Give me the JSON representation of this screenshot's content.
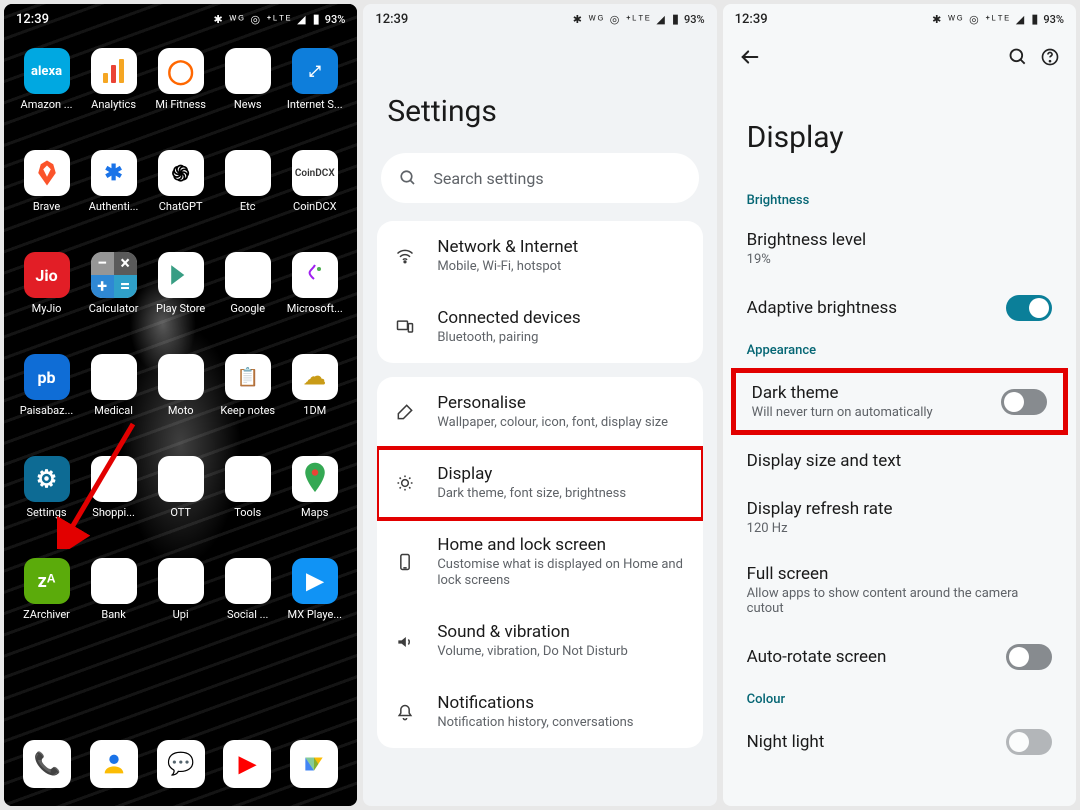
{
  "status": {
    "time": "12:39",
    "icons": "✱ ᵂᴳ ◎ ⁺ᴸᵀᴱ ◢",
    "battery": "93%"
  },
  "home": {
    "apps": [
      {
        "label": "Amazon ...",
        "name": "amazon-alexa-icon",
        "cls": "ic-alexa",
        "glyph": "alexa"
      },
      {
        "label": "Analytics",
        "name": "analytics-icon",
        "cls": "ic-analytics",
        "glyph": ""
      },
      {
        "label": "Mi Fitness",
        "name": "mi-fitness-icon",
        "cls": "ic-mifitness",
        "glyph": "◯"
      },
      {
        "label": "News",
        "name": "news-icon",
        "cls": "ic-news",
        "glyph": ""
      },
      {
        "label": "Internet S...",
        "name": "internet-speed-icon",
        "cls": "ic-inet",
        "glyph": "⤢"
      },
      {
        "label": "Brave",
        "name": "brave-icon",
        "cls": "ic-brave",
        "glyph": ""
      },
      {
        "label": "Authenti...",
        "name": "authenticator-icon",
        "cls": "ic-authentic",
        "glyph": "✱"
      },
      {
        "label": "ChatGPT",
        "name": "chatgpt-icon",
        "cls": "ic-chatgpt",
        "glyph": "֍"
      },
      {
        "label": "Etc",
        "name": "etc-folder-icon",
        "cls": "ic-etc",
        "glyph": ""
      },
      {
        "label": "CoinDCX",
        "name": "coindcx-icon",
        "cls": "ic-coindcx",
        "glyph": "CoinDCX"
      },
      {
        "label": "MyJio",
        "name": "myjio-icon",
        "cls": "ic-jio",
        "glyph": "Jio"
      },
      {
        "label": "Calculator",
        "name": "calculator-icon",
        "cls": "ic-calc",
        "glyph": ""
      },
      {
        "label": "Play Store",
        "name": "play-store-icon",
        "cls": "ic-play",
        "glyph": ""
      },
      {
        "label": "Google",
        "name": "google-folder-icon",
        "cls": "ic-google",
        "glyph": ""
      },
      {
        "label": "Microsoft...",
        "name": "microsoft-icon",
        "cls": "ic-ms",
        "glyph": ""
      },
      {
        "label": "Paisabaz...",
        "name": "paisabazaar-icon",
        "cls": "ic-pb",
        "glyph": "pb"
      },
      {
        "label": "Medical",
        "name": "medical-folder-icon",
        "cls": "ic-medical",
        "glyph": ""
      },
      {
        "label": "Moto",
        "name": "moto-folder-icon",
        "cls": "ic-moto",
        "glyph": ""
      },
      {
        "label": "Keep notes",
        "name": "keep-notes-icon",
        "cls": "ic-keep",
        "glyph": "📋"
      },
      {
        "label": "1DM",
        "name": "1dm-icon",
        "cls": "ic-1dm",
        "glyph": "☁"
      },
      {
        "label": "Settings",
        "name": "settings-icon",
        "cls": "ic-settings",
        "glyph": "⚙"
      },
      {
        "label": "Shoppi...",
        "name": "shopping-folder-icon",
        "cls": "ic-shoppi",
        "glyph": ""
      },
      {
        "label": "OTT",
        "name": "ott-folder-icon",
        "cls": "ic-ott",
        "glyph": ""
      },
      {
        "label": "Tools",
        "name": "tools-folder-icon",
        "cls": "ic-tools",
        "glyph": ""
      },
      {
        "label": "Maps",
        "name": "maps-icon",
        "cls": "ic-maps",
        "glyph": "📍"
      },
      {
        "label": "ZArchiver",
        "name": "zarchiver-icon",
        "cls": "ic-za",
        "glyph": "zᴬ"
      },
      {
        "label": "Bank",
        "name": "bank-folder-icon",
        "cls": "ic-bank",
        "glyph": ""
      },
      {
        "label": "Upi",
        "name": "upi-folder-icon",
        "cls": "ic-upi",
        "glyph": ""
      },
      {
        "label": "Social ...",
        "name": "social-folder-icon",
        "cls": "ic-social",
        "glyph": ""
      },
      {
        "label": "MX Playe...",
        "name": "mx-player-icon",
        "cls": "ic-play2",
        "glyph": "▶"
      }
    ],
    "favorites": [
      {
        "name": "phone-icon",
        "cls": "ic-phone",
        "glyph": "📞"
      },
      {
        "name": "contacts-icon",
        "cls": "ic-contacts",
        "glyph": ""
      },
      {
        "name": "messages-icon",
        "cls": "ic-messages",
        "glyph": "💬"
      },
      {
        "name": "youtube-icon",
        "cls": "ic-yt",
        "glyph": "▶"
      },
      {
        "name": "files-icon",
        "cls": "ic-files",
        "glyph": ""
      }
    ]
  },
  "settings": {
    "title": "Settings",
    "search_placeholder": "Search settings",
    "rows": [
      {
        "title": "Network & Internet",
        "sub": "Mobile, Wi-Fi, hotspot",
        "name": "network-internet-row",
        "icon": "wifi"
      },
      {
        "title": "Connected devices",
        "sub": "Bluetooth, pairing",
        "name": "connected-devices-row",
        "icon": "devices"
      },
      {
        "title": "Personalise",
        "sub": "Wallpaper, colour, icon, font, display size",
        "name": "personalise-row",
        "icon": "brush"
      },
      {
        "title": "Display",
        "sub": "Dark theme, font size, brightness",
        "name": "display-row",
        "icon": "brightness",
        "highlight": true
      },
      {
        "title": "Home and lock screen",
        "sub": "Customise what is displayed on Home and lock screens",
        "name": "home-lock-row",
        "icon": "phone"
      },
      {
        "title": "Sound & vibration",
        "sub": "Volume, vibration, Do Not Disturb",
        "name": "sound-row",
        "icon": "volume"
      },
      {
        "title": "Notifications",
        "sub": "Notification history, conversations",
        "name": "notifications-row",
        "icon": "bell"
      }
    ]
  },
  "display": {
    "title": "Display",
    "sections": {
      "brightness": "Brightness",
      "appearance": "Appearance",
      "colour": "Colour"
    },
    "rows": {
      "brightness_level": {
        "title": "Brightness level",
        "sub": "19%"
      },
      "adaptive": {
        "title": "Adaptive brightness"
      },
      "dark_theme": {
        "title": "Dark theme",
        "sub": "Will never turn on automatically"
      },
      "display_size": {
        "title": "Display size and text"
      },
      "refresh_rate": {
        "title": "Display refresh rate",
        "sub": "120 Hz"
      },
      "full_screen": {
        "title": "Full screen",
        "sub": "Allow apps to show content around the camera cutout"
      },
      "auto_rotate": {
        "title": "Auto-rotate screen"
      },
      "night_light": {
        "title": "Night light"
      }
    }
  }
}
